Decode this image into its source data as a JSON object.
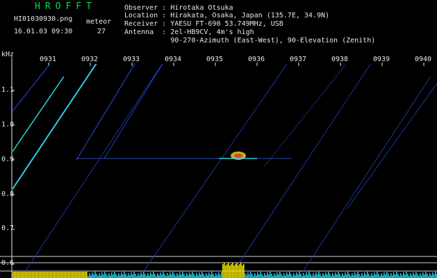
{
  "header": {
    "brand": "HROFFT",
    "filename": "HI01030930.png",
    "datetime": "16.01.03 09:30",
    "meteor_label": "meteor",
    "meteor_count": "27",
    "info_lines": [
      "Observer : Hirotaka Otsuka",
      "Location : Hirakata, Osaka, Japan (135.7E, 34.9N)",
      "Receiver : YAESU FT-690 53.749MHz, USB",
      "Antenna  : 2el-HB9CV, 4m's high",
      "           90-270-Azimuth (East-West), 90-Elevation (Zenith)"
    ]
  },
  "axis": {
    "y_unit": "kHz",
    "y_ticks": [
      "1.1",
      "1.0",
      "0.9",
      "0.8",
      "0.7",
      "0.6"
    ],
    "x_ticks": [
      "0931",
      "0932",
      "0933",
      "0934",
      "0935",
      "0936",
      "0937",
      "0938",
      "0939",
      "0940"
    ]
  },
  "colors": {
    "background": "#000000",
    "brand": "#00e050",
    "text": "#e8e8e8",
    "trace_blue": "#2040c0",
    "trace_cyan": "#30d0e0",
    "spectrum": "#20c8e8",
    "spectrum_peak": "#f0e000"
  }
}
